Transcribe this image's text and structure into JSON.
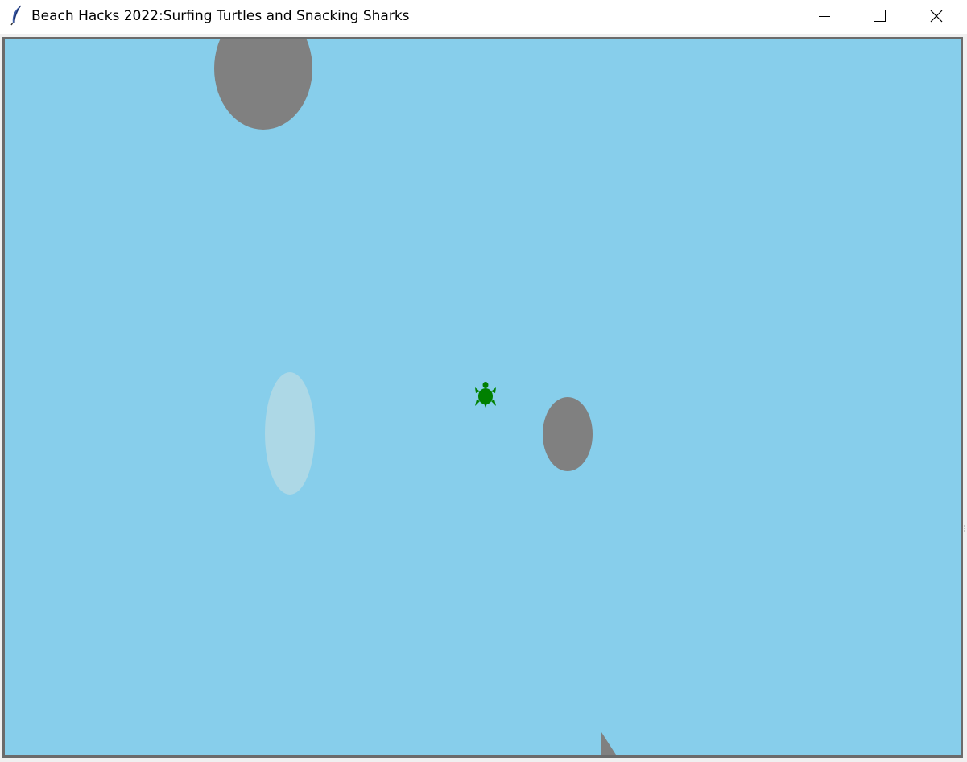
{
  "window": {
    "title": "Beach Hacks 2022:Surfing Turtles and Snacking Sharks",
    "app_icon": "feather-icon",
    "controls": [
      "minimize-icon",
      "maximize-icon",
      "close-icon"
    ]
  },
  "scene": {
    "background_color": "#87CEEB",
    "rock_color": "#808080",
    "wave_color": "#ADD8E6",
    "turtle_color": "#008000",
    "shark_fin_color": "#808080",
    "objects": [
      "rock",
      "rock",
      "wave",
      "turtle",
      "shark-fin"
    ]
  }
}
